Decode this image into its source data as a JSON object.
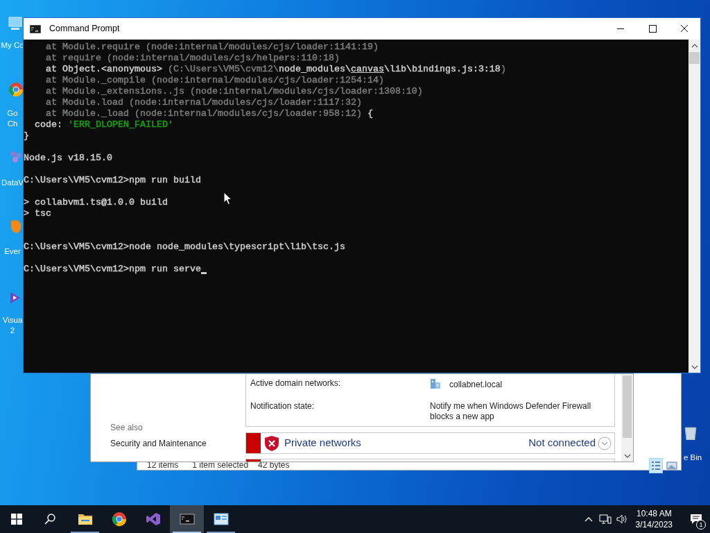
{
  "desktop_icons": [
    {
      "kind": "computer",
      "lines": [
        "My Co"
      ]
    },
    {
      "kind": "chrome",
      "lines": [
        "Go",
        "Ch"
      ]
    },
    {
      "kind": "dataviz",
      "lines": [
        "DataV"
      ]
    },
    {
      "kind": "evernote",
      "lines": [
        "Ever"
      ]
    },
    {
      "kind": "studio",
      "lines": [
        "Visua",
        "2"
      ]
    },
    {
      "kind": "recycle",
      "lines": [
        "e Bin"
      ]
    }
  ],
  "explorer_window": {
    "status_bar": [
      "12 items",
      "1 item selected",
      "42 bytes"
    ]
  },
  "firewall_window": {
    "details": [
      {
        "label": "Active domain networks:",
        "value": "collabnet.local",
        "kind": "domain"
      },
      {
        "label": "Notification state:",
        "value": "Notify me when Windows Defender Firewall blocks a new app",
        "kind": "text"
      }
    ],
    "see_also": {
      "heading": "See also",
      "links": [
        "Security and Maintenance"
      ]
    },
    "network_rows": [
      {
        "name": "Private networks",
        "status": "Not connected"
      }
    ]
  },
  "cmd_window": {
    "title": "Command Prompt",
    "lines": [
      {
        "kind": "text",
        "segments": [
          {
            "text": "    at Module.require (node:internal/modules/cjs/loader:1141:19)",
            "color": "#7a7a7a"
          }
        ]
      },
      {
        "kind": "text",
        "segments": [
          {
            "text": "    at require (node:internal/modules/cjs/helpers:110:18)",
            "color": "#7a7a7a"
          }
        ]
      },
      {
        "kind": "text",
        "segments": [
          {
            "text": "    at Object.<anonymous> ",
            "color": "#cccccc"
          },
          {
            "text": "(C:\\Users\\VM5\\cvm12\\",
            "color": "#7a7a7a"
          },
          {
            "text": "node_modules\\",
            "color": "#cccccc"
          },
          {
            "text": "canvas",
            "color": "#cccccc",
            "underline": true
          },
          {
            "text": "\\lib\\bindings.js:3:18",
            "color": "#cccccc"
          },
          {
            "text": ")",
            "color": "#7a7a7a"
          }
        ]
      },
      {
        "kind": "text",
        "segments": [
          {
            "text": "    at Module._compile (node:internal/modules/cjs/loader:1254:14)",
            "color": "#7a7a7a"
          }
        ]
      },
      {
        "kind": "text",
        "segments": [
          {
            "text": "    at Module._extensions..js (node:internal/modules/cjs/loader:1308:10)",
            "color": "#7a7a7a"
          }
        ]
      },
      {
        "kind": "text",
        "segments": [
          {
            "text": "    at Module.load (node:internal/modules/cjs/loader:1117:32)",
            "color": "#7a7a7a"
          }
        ]
      },
      {
        "kind": "text",
        "segments": [
          {
            "text": "    at Module._load (node:internal/modules/cjs/loader:958:12)",
            "color": "#7a7a7a"
          },
          {
            "text": " {",
            "color": "#cccccc"
          }
        ]
      },
      {
        "kind": "text",
        "segments": [
          {
            "text": "  code: ",
            "color": "#cccccc"
          },
          {
            "text": "'ERR_DLOPEN_FAILED'",
            "color": "#13a10e"
          }
        ]
      },
      {
        "kind": "text",
        "segments": [
          {
            "text": "}",
            "color": "#cccccc"
          }
        ]
      },
      {
        "kind": "blank"
      },
      {
        "kind": "text",
        "segments": [
          {
            "text": "Node.js v18.15.0",
            "color": "#cccccc"
          }
        ]
      },
      {
        "kind": "blank"
      },
      {
        "kind": "text",
        "segments": [
          {
            "text": "C:\\Users\\VM5\\cvm12>npm run build",
            "color": "#cccccc"
          }
        ]
      },
      {
        "kind": "blank"
      },
      {
        "kind": "text",
        "segments": [
          {
            "text": "> collabvm1.ts@1.0.0 build",
            "color": "#cccccc"
          }
        ]
      },
      {
        "kind": "text",
        "segments": [
          {
            "text": "> tsc",
            "color": "#cccccc"
          }
        ]
      },
      {
        "kind": "blank"
      },
      {
        "kind": "blank"
      },
      {
        "kind": "text",
        "segments": [
          {
            "text": "C:\\Users\\VM5\\cvm12>node node_modules\\typescript\\lib\\tsc.js",
            "color": "#cccccc"
          }
        ]
      },
      {
        "kind": "blank"
      },
      {
        "kind": "prompt",
        "segments": [
          {
            "text": "C:\\Users\\VM5\\cvm12>npm run serve",
            "color": "#cccccc"
          }
        ]
      }
    ]
  },
  "taskbar": {
    "apps": [
      {
        "kind": "folder",
        "running": true,
        "active": false
      },
      {
        "kind": "chrome",
        "running": false,
        "active": false
      },
      {
        "kind": "studio",
        "running": false,
        "active": false
      },
      {
        "kind": "console",
        "running": true,
        "active": true
      },
      {
        "kind": "firewall",
        "running": true,
        "active": false
      }
    ],
    "clock": {
      "time": "10:48 AM",
      "date": "3/14/2023"
    },
    "notifications": {
      "count": "1"
    }
  }
}
